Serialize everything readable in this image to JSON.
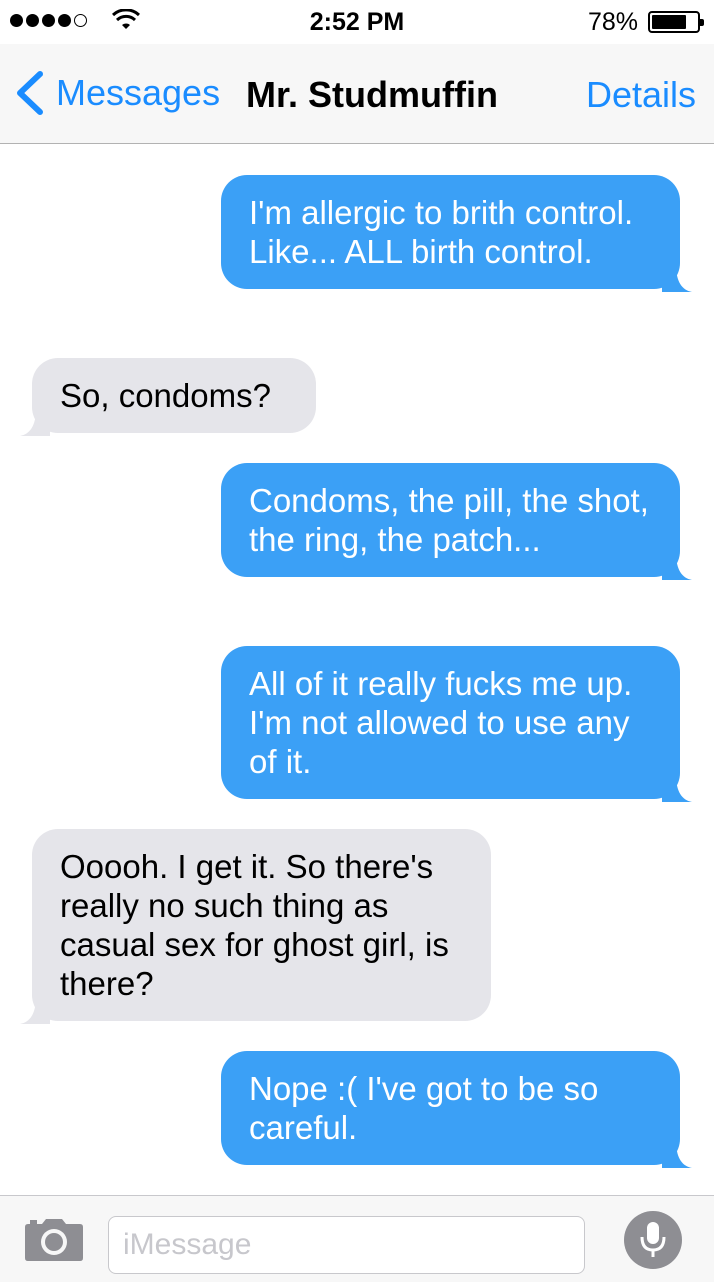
{
  "status_bar": {
    "time": "2:52 PM",
    "battery_percent": "78%",
    "battery_level": 0.78,
    "signal_bars": 4,
    "signal_max": 5
  },
  "nav": {
    "back_label": "Messages",
    "title": "Mr. Studmuffin",
    "details_label": "Details"
  },
  "messages": [
    {
      "direction": "sent",
      "text": "I'm allergic to brith control. Like... ALL birth control."
    },
    {
      "direction": "received",
      "text": "So, condoms?"
    },
    {
      "direction": "sent",
      "text": "Condoms, the pill, the shot, the ring, the patch..."
    },
    {
      "direction": "sent",
      "text": "All of it really fucks me up. I'm not allowed to use any of it."
    },
    {
      "direction": "received",
      "text": "Ooooh. I get it. So there's really no such thing as casual sex for ghost girl, is there?"
    },
    {
      "direction": "sent",
      "text": "Nope :( I've got to be so careful."
    }
  ],
  "composer": {
    "placeholder": "iMessage",
    "value": ""
  },
  "icons": {
    "back": "chevron-left-icon",
    "camera": "camera-icon",
    "mic": "microphone-icon",
    "wifi": "wifi-icon",
    "battery": "battery-icon"
  },
  "colors": {
    "sent_bubble": "#3ba0f6",
    "received_bubble": "#e5e5ea",
    "accent": "#1a8cff",
    "mic_button": "#8e8e93"
  }
}
